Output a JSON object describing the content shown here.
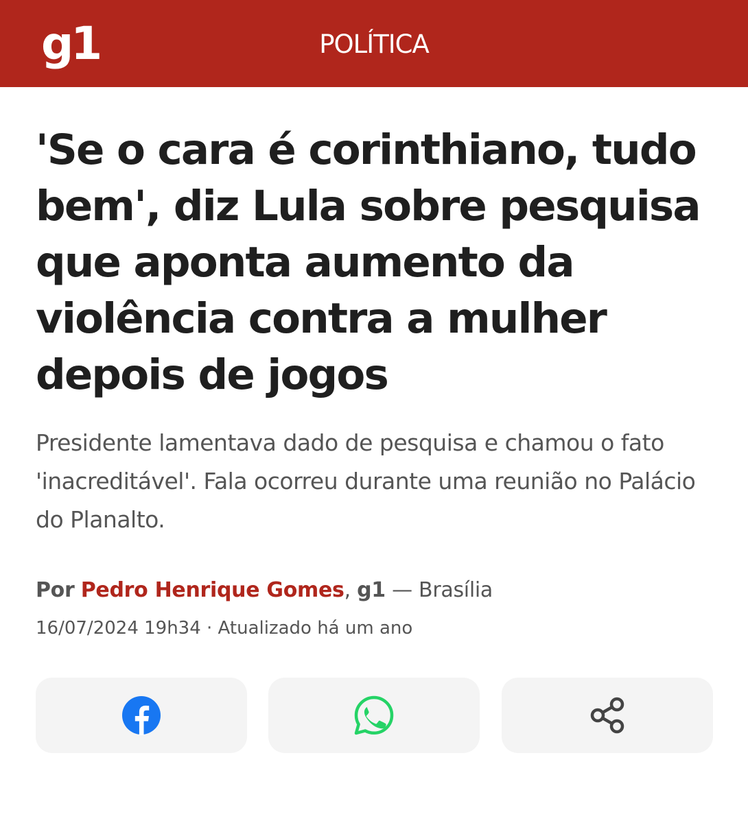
{
  "header": {
    "logo_text": "g1",
    "section": "POLÍTICA",
    "bar_color": "#b0261c"
  },
  "article": {
    "headline": "'Se o cara é corinthiano, tudo bem', diz Lula sobre pesquisa que aponta aumento da violência contra a mulher depois de jogos",
    "subtitle": "Presidente lamentava dado de pesquisa e chamou o fato 'inacreditável'. Fala ocorreu durante uma reunião no Palácio do Planalto.",
    "byline": {
      "prefix": "Por",
      "author": "Pedro Henrique Gomes",
      "separator": ",",
      "outlet": "g1",
      "location": "— Brasília"
    },
    "dateline": "16/07/2024 19h34 · Atualizado há um ano"
  },
  "share": {
    "buttons": [
      {
        "icon": "facebook-icon",
        "color": "#1877f2"
      },
      {
        "icon": "whatsapp-icon",
        "color": "#25d366"
      },
      {
        "icon": "share-icon",
        "color": "#444444"
      }
    ]
  },
  "colors": {
    "accent": "#b0261c",
    "text_primary": "#1f1f1f",
    "text_secondary": "#555555",
    "button_bg": "#f4f4f4"
  }
}
